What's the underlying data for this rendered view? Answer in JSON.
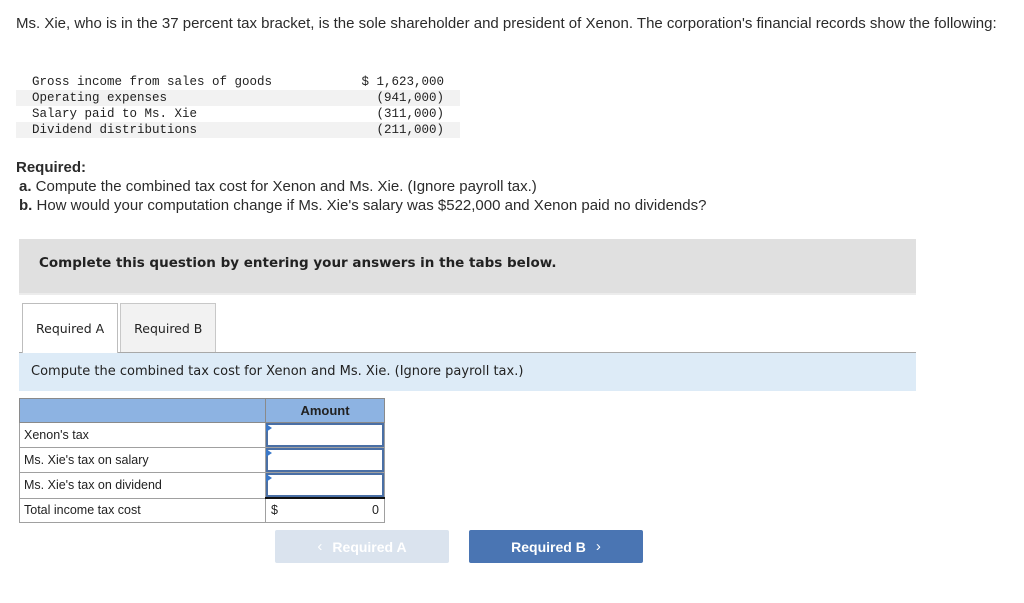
{
  "intro": {
    "text": "Ms. Xie, who is in the 37 percent tax bracket, is the sole shareholder and president of Xenon. The corporation's financial records show the following:"
  },
  "records": [
    {
      "label": "Gross income from sales of goods",
      "value": "$ 1,623,000"
    },
    {
      "label": "Operating expenses",
      "value": "(941,000)"
    },
    {
      "label": "Salary paid to Ms. Xie",
      "value": "(311,000)"
    },
    {
      "label": "Dividend distributions",
      "value": "(211,000)"
    }
  ],
  "required": {
    "heading": "Required:",
    "items": [
      {
        "letter": "a.",
        "text": " Compute the combined tax cost for Xenon and Ms. Xie. (Ignore payroll tax.)"
      },
      {
        "letter": "b.",
        "text": " How would your computation change if Ms. Xie's salary was $522,000 and Xenon paid no dividends?"
      }
    ]
  },
  "banner": {
    "text": "Complete this question by entering your answers in the tabs below."
  },
  "tabs": [
    {
      "label": "Required A",
      "active": true
    },
    {
      "label": "Required B",
      "active": false
    }
  ],
  "instruction": {
    "text": "Compute the combined tax cost for Xenon and Ms. Xie. (Ignore payroll tax.)"
  },
  "table": {
    "header_label": "",
    "header_amount": "Amount",
    "rows": [
      {
        "label": "Xenon's tax",
        "value": ""
      },
      {
        "label": "Ms. Xie's tax on salary",
        "value": ""
      },
      {
        "label": "Ms. Xie's tax on dividend",
        "value": ""
      }
    ],
    "total": {
      "label": "Total income tax cost",
      "currency": "$",
      "value": "0"
    }
  },
  "nav": {
    "prev_label": "Required A",
    "prev_chevron": "‹",
    "next_label": "Required B",
    "next_chevron": "›",
    "prev_enabled": false,
    "next_enabled": true
  }
}
